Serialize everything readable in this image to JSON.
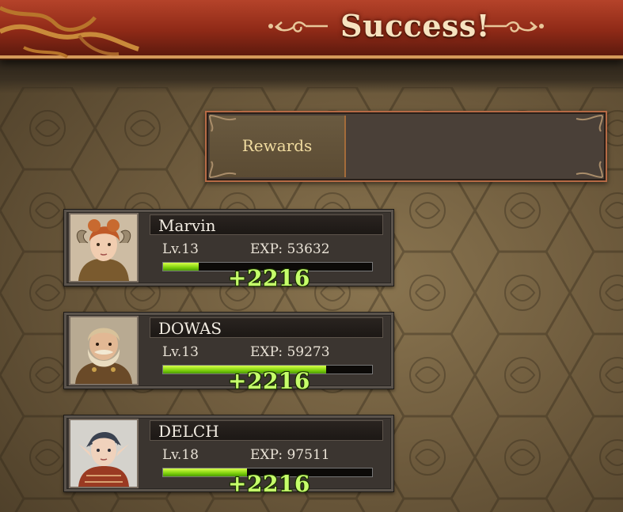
{
  "header": {
    "title": "Success!"
  },
  "rewards": {
    "label": "Rewards"
  },
  "characters": [
    {
      "name": "Marvin",
      "level": "Lv.13",
      "exp": "EXP: 53632",
      "exp_fill": 0.17,
      "gain": "+2216",
      "portrait": "elf-girl-portrait"
    },
    {
      "name": "DOWAS",
      "level": "Lv.13",
      "exp": "EXP: 59273",
      "exp_fill": 0.78,
      "gain": "+2216",
      "portrait": "dwarf-portrait"
    },
    {
      "name": "DELCH",
      "level": "Lv.18",
      "exp": "EXP: 97511",
      "exp_fill": 0.4,
      "gain": "+2216",
      "portrait": "elf-boy-portrait"
    }
  ],
  "colors": {
    "title_bar": "#8f2a17",
    "exp_bar": "#7ed10d",
    "gain_text": "#c6ff6b",
    "rewards_label": "#f1dca0"
  }
}
